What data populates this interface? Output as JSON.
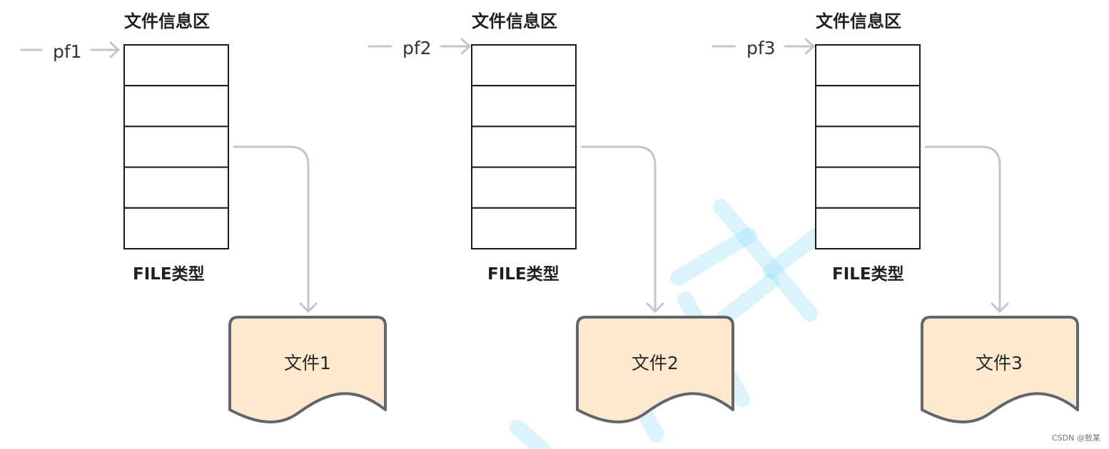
{
  "groups": [
    {
      "title": "文件信息区",
      "pointer": "pf1",
      "type_label": "FILE类型",
      "file_label": "文件1"
    },
    {
      "title": "文件信息区",
      "pointer": "pf2",
      "type_label": "FILE类型",
      "file_label": "文件2"
    },
    {
      "title": "文件信息区",
      "pointer": "pf3",
      "type_label": "FILE类型",
      "file_label": "文件3"
    }
  ],
  "block_rows": 5,
  "footer": "CSDN @敖某",
  "colors": {
    "line": "#c3c6c9",
    "box_stroke": "#1a1a1a",
    "file_fill": "#fde9d0",
    "file_stroke": "#62656b",
    "watermark": "#7fd8f5"
  }
}
